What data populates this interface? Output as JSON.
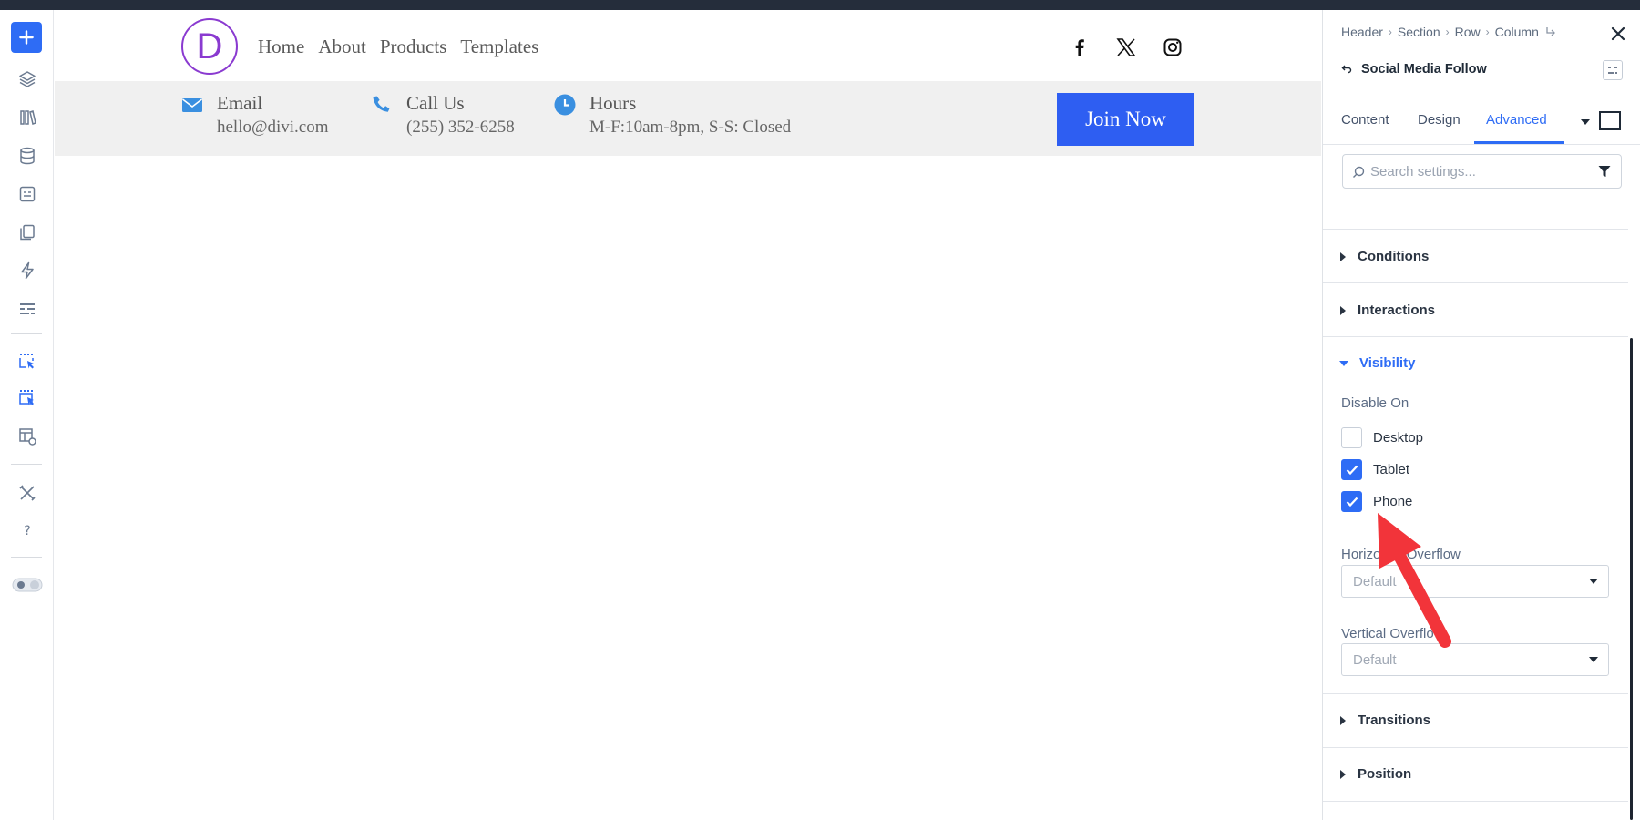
{
  "canvas": {
    "nav": [
      "Home",
      "About",
      "Products",
      "Templates"
    ],
    "info": [
      {
        "icon": "envelope-icon",
        "title": "Email",
        "detail": "hello@divi.com"
      },
      {
        "icon": "phone-icon",
        "title": "Call Us",
        "detail": "(255) 352-6258"
      },
      {
        "icon": "clock-icon",
        "title": "Hours",
        "detail": "M-F:10am-8pm, S-S: Closed"
      }
    ],
    "logo_letter": "D",
    "cta_label": "Join Now",
    "social": [
      "facebook-icon",
      "x-icon",
      "instagram-icon"
    ]
  },
  "panel": {
    "breadcrumb": [
      "Header",
      "Section",
      "Row",
      "Column"
    ],
    "module_title": "Social Media Follow",
    "tabs": [
      "Content",
      "Design",
      "Advanced"
    ],
    "active_tab": "Advanced",
    "search_placeholder": "Search settings...",
    "sections": {
      "conditions": "Conditions",
      "interactions": "Interactions",
      "visibility": "Visibility",
      "transitions": "Transitions",
      "position": "Position"
    },
    "visibility": {
      "disable_on_label": "Disable On",
      "options": [
        {
          "label": "Desktop",
          "checked": false
        },
        {
          "label": "Tablet",
          "checked": true
        },
        {
          "label": "Phone",
          "checked": true
        }
      ],
      "horizontal_overflow_label": "Horizontal Overflow",
      "horizontal_overflow_value": "Default",
      "vertical_overflow_label": "Vertical Overflow",
      "vertical_overflow_value": "Default"
    }
  },
  "colors": {
    "accent": "#2e6cf5",
    "logo": "#8a3ad0",
    "cta": "#2e5ef2",
    "annotation_arrow": "#f2343a",
    "topbar": "#252d3b"
  }
}
